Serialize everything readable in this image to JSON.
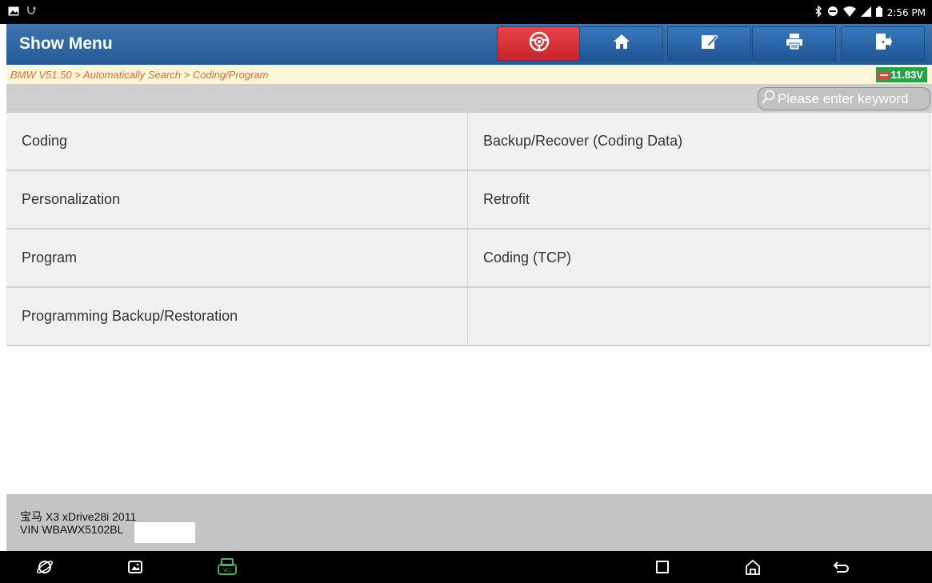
{
  "status_bar": {
    "time": "2:56 PM",
    "left_icons": [
      "image-icon",
      "usb-debug-icon"
    ],
    "right_icons": [
      "bluetooth-icon",
      "do-not-disturb-icon",
      "wifi-icon",
      "cell-signal-icon",
      "battery-icon"
    ]
  },
  "header": {
    "title": "Show Menu",
    "buttons": [
      {
        "name": "steering-wheel-icon",
        "color": "#d9313a"
      },
      {
        "name": "home-icon"
      },
      {
        "name": "edit-report-icon"
      },
      {
        "name": "print-icon"
      },
      {
        "name": "exit-icon"
      }
    ]
  },
  "breadcrumb": {
    "path": "BMW V51.50 > Automatically Search > Coding/Program",
    "voltage": "11.83V"
  },
  "search": {
    "placeholder": "Please enter keyword"
  },
  "menu": {
    "items": [
      "Coding",
      "Backup/Recover (Coding Data)",
      "Personalization",
      "Retrofit",
      "Program",
      "Coding (TCP)",
      "Programming Backup/Restoration",
      ""
    ]
  },
  "vehicle": {
    "model_line": "宝马 X3 xDrive28i 2011",
    "vin_line": "VIN WBAWX5102BL"
  },
  "nav_bar": {
    "icons": [
      "browser-icon",
      "gallery-icon",
      "vci-icon",
      "recent-apps-icon",
      "home-nav-icon",
      "back-icon"
    ]
  },
  "colors": {
    "header_blue": "#2f66a3",
    "breadcrumb_text": "#e56d2f",
    "voltage_green": "#2aa24a",
    "vci_green": "#4caf50"
  }
}
